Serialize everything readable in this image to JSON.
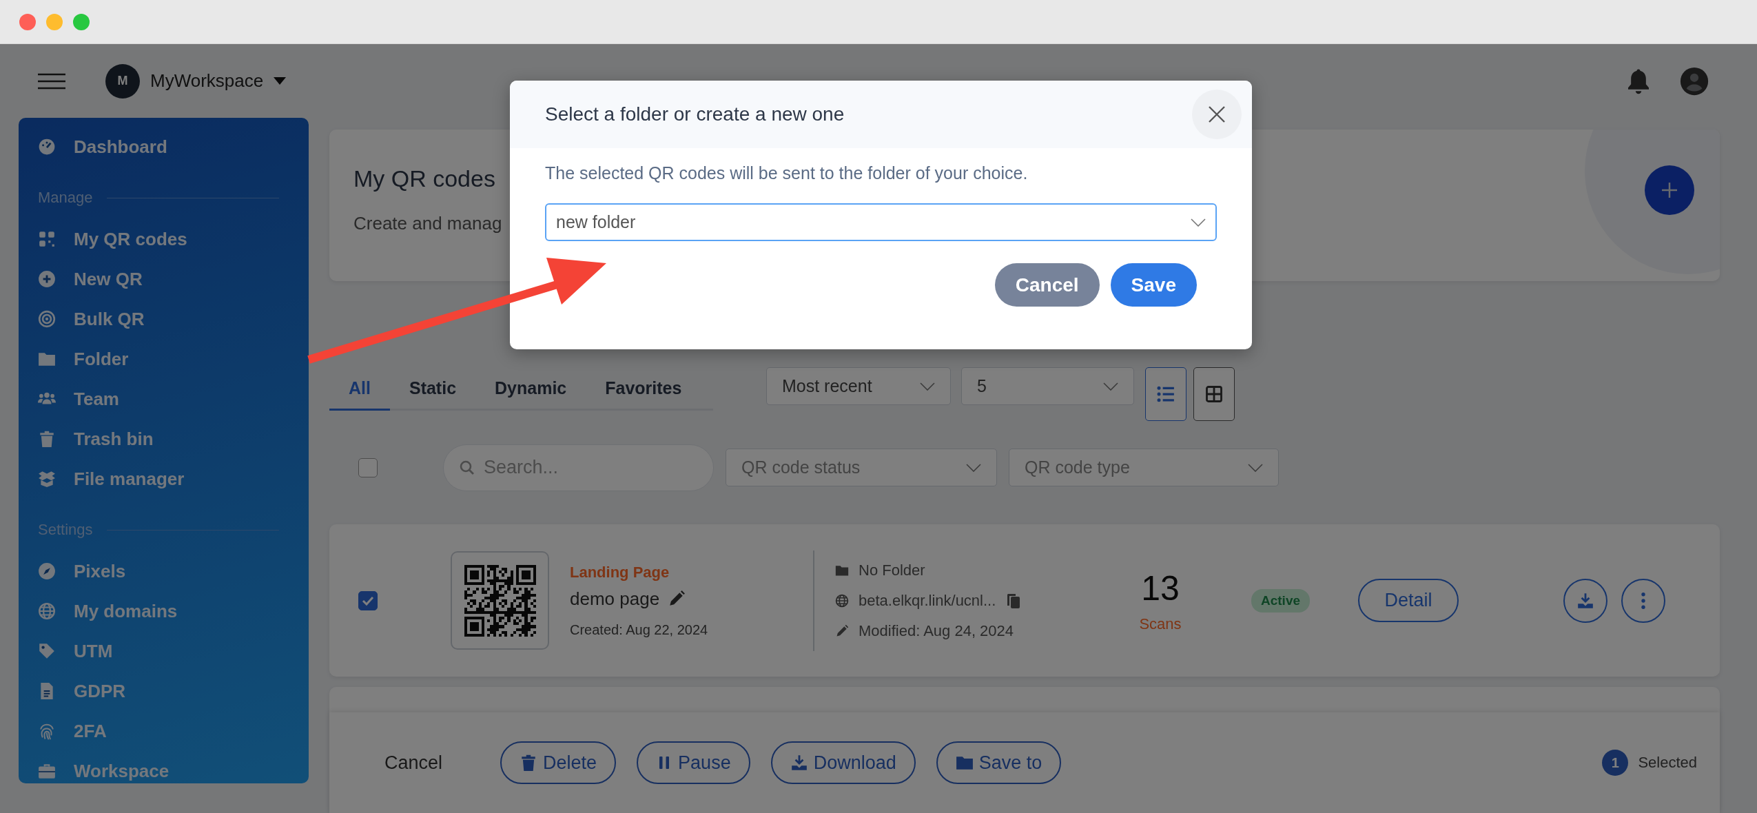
{
  "topbar": {
    "workspace_initial": "M",
    "workspace_name": "MyWorkspace"
  },
  "sidebar": {
    "sections": [
      {
        "items": [
          {
            "label": "Dashboard"
          }
        ]
      },
      {
        "title": "Manage",
        "items": [
          {
            "label": "My QR codes"
          },
          {
            "label": "New QR"
          },
          {
            "label": "Bulk QR"
          },
          {
            "label": "Folder"
          },
          {
            "label": "Team"
          },
          {
            "label": "Trash bin"
          },
          {
            "label": "File manager"
          }
        ]
      },
      {
        "title": "Settings",
        "items": [
          {
            "label": "Pixels"
          },
          {
            "label": "My domains"
          },
          {
            "label": "UTM"
          },
          {
            "label": "GDPR"
          },
          {
            "label": "2FA"
          },
          {
            "label": "Workspace"
          }
        ]
      }
    ]
  },
  "header": {
    "title": "My QR codes",
    "subtitle": "Create and manag"
  },
  "tabs": [
    {
      "label": "All",
      "selected": true
    },
    {
      "label": "Static",
      "selected": false
    },
    {
      "label": "Dynamic",
      "selected": false
    },
    {
      "label": "Favorites",
      "selected": false
    }
  ],
  "sort_select": {
    "value": "Most recent"
  },
  "page_size_select": {
    "value": "5"
  },
  "view_buttons": [
    {
      "selected": true
    },
    {
      "selected": false
    }
  ],
  "filters": {
    "select_all_checked": false,
    "search_placeholder": "Search...",
    "status_placeholder": "QR code status",
    "type_placeholder": "QR code type"
  },
  "rows": [
    {
      "checked": true,
      "type": "Landing Page",
      "name": "demo page",
      "created": "Created: Aug 22, 2024",
      "folder": "No Folder",
      "link": "beta.elkqr.link/ucnl...",
      "modified": "Modified: Aug 24, 2024",
      "scans": "13",
      "scans_label": "Scans",
      "status": "Active",
      "action": "Detail"
    }
  ],
  "bulk_bar": {
    "cancel": "Cancel",
    "actions": [
      "Delete",
      "Pause",
      "Download",
      "Save to"
    ],
    "count": "1",
    "count_label": "Selected"
  },
  "dialog": {
    "title": "Select a folder or create a new one",
    "message": "The selected QR codes will be sent to the folder of your choice.",
    "folder_select": {
      "value": "new folder"
    },
    "buttons": [
      {
        "label": "Cancel",
        "kind": "secondary"
      },
      {
        "label": "Save",
        "kind": "primary"
      }
    ]
  }
}
